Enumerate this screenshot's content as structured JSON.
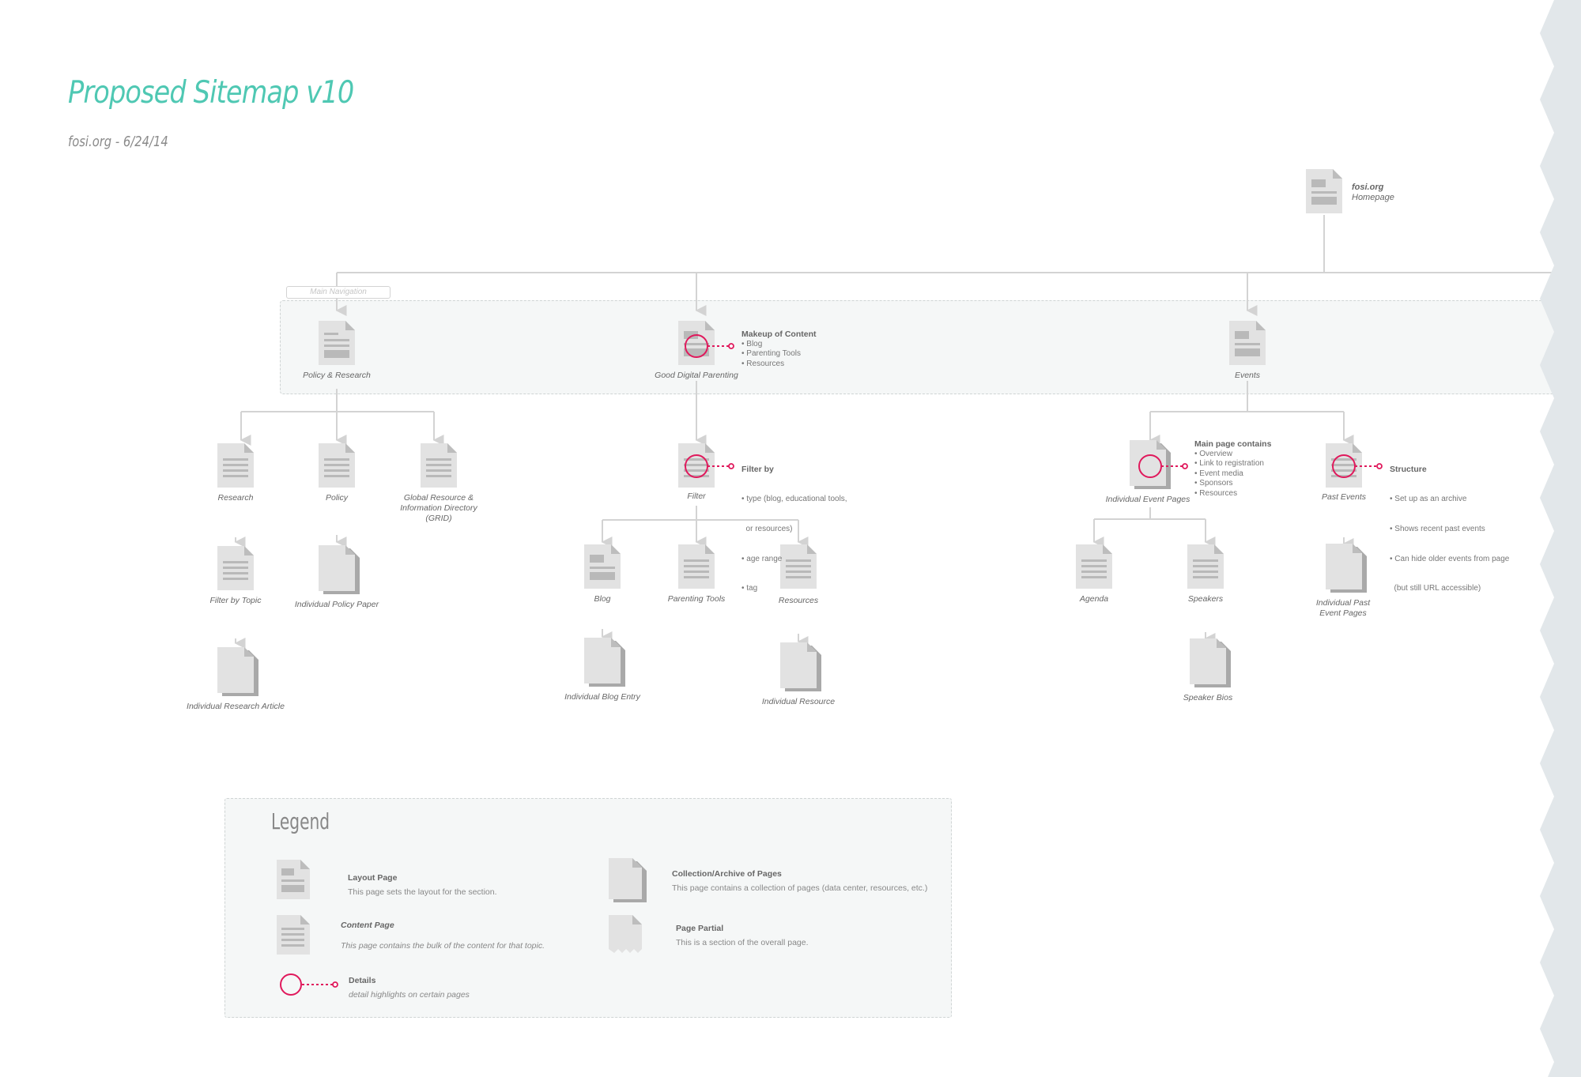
{
  "header": {
    "title": "Proposed Sitemap v10",
    "subtitle": "fosi.org - 6/24/14"
  },
  "main_navigation_label": "Main Navigation",
  "colors": {
    "accent": "#4fc8b3",
    "detail_marker": "#e0195c",
    "connector": "#d3d3d3",
    "page_icon": "#e2e2e2"
  },
  "nodes": {
    "homepage": {
      "icon": "layout-page",
      "site": "fosi.org",
      "label": "Homepage"
    },
    "policy_research": {
      "icon": "content-page",
      "label": "Policy & Research"
    },
    "good_digital_parenting": {
      "icon": "layout-page",
      "label": "Good Digital Parenting"
    },
    "events": {
      "icon": "layout-page",
      "label": "Events"
    },
    "research": {
      "icon": "content-page",
      "label": "Research"
    },
    "policy": {
      "icon": "content-page",
      "label": "Policy"
    },
    "grid": {
      "icon": "content-page",
      "label": "Global Resource & Information Directory (GRID)"
    },
    "filter_by_topic": {
      "icon": "content-page",
      "label": "Filter by Topic"
    },
    "individual_policy_paper": {
      "icon": "collection-page",
      "label": "Individual Policy Paper"
    },
    "individual_research_article": {
      "icon": "collection-page",
      "label": "Individual Research Article"
    },
    "filter": {
      "icon": "content-page",
      "label": "Filter"
    },
    "blog": {
      "icon": "layout-page",
      "label": "Blog"
    },
    "parenting_tools": {
      "icon": "content-page",
      "label": "Parenting Tools"
    },
    "resources": {
      "icon": "content-page",
      "label": "Resources"
    },
    "individual_blog_entry": {
      "icon": "collection-page",
      "label": "Individual Blog Entry"
    },
    "individual_resource": {
      "icon": "collection-page",
      "label": "Individual Resource"
    },
    "individual_event_pages": {
      "icon": "collection-page",
      "label": "Individual Event Pages"
    },
    "past_events": {
      "icon": "content-page",
      "label": "Past Events"
    },
    "agenda": {
      "icon": "content-page",
      "label": "Agenda"
    },
    "speakers": {
      "icon": "content-page",
      "label": "Speakers"
    },
    "speaker_bios": {
      "icon": "collection-page",
      "label": "Speaker Bios"
    },
    "individual_past_event_pages": {
      "icon": "collection-page",
      "label": "Individual Past Event Pages"
    }
  },
  "details": {
    "makeup": {
      "title": "Makeup of Content",
      "items": [
        "• Blog",
        "• Parenting Tools",
        "• Resources"
      ]
    },
    "filter_by": {
      "title": "Filter by",
      "items": [
        "• type (blog, educational tools,",
        "  or resources)",
        "• age range",
        "• tag"
      ]
    },
    "main_page": {
      "title": "Main page contains",
      "items": [
        "• Overview",
        "• Link to registration",
        "• Event media",
        "• Sponsors",
        "• Resources"
      ]
    },
    "structure": {
      "title": "Structure",
      "items": [
        "• Set up as an archive",
        "• Shows recent past events",
        "• Can hide older events from page",
        "  (but still URL accessible)"
      ]
    }
  },
  "legend": {
    "title": "Legend",
    "items": [
      {
        "icon": "layout-page",
        "name": "Layout Page",
        "desc": "This page sets the layout for the section."
      },
      {
        "icon": "content-page",
        "name": "Content Page",
        "desc": "This page contains the bulk of the content for that topic."
      },
      {
        "icon": "details-marker",
        "name": "Details",
        "desc": "detail highlights on certain pages"
      },
      {
        "icon": "collection-page",
        "name": "Collection/Archive of Pages",
        "desc": "This page contains a collection of pages (data center, resources, etc.)"
      },
      {
        "icon": "page-partial",
        "name": "Page Partial",
        "desc": "This is a section of the overall page."
      }
    ]
  }
}
